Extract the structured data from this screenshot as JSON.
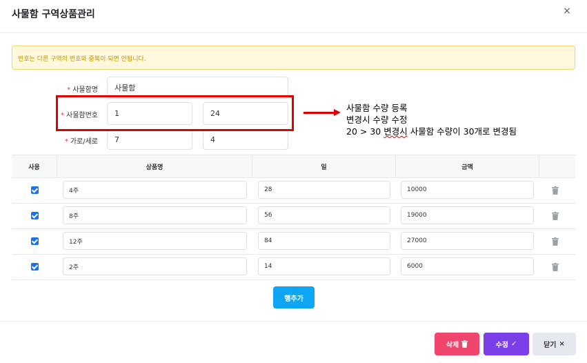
{
  "modal": {
    "title": "사물함 구역상품관리",
    "close_glyph": "×"
  },
  "alert": {
    "text": "번호는 다른 구역의 번호와 중복이 되면 안됩니다."
  },
  "form": {
    "locker_name_label": "사물함명",
    "locker_name_value": "사물함",
    "locker_number_label": "사물함번호",
    "locker_number_from": "1",
    "locker_number_to": "24",
    "size_label": "가로/세로",
    "width_value": "7",
    "height_value": "4",
    "required_mark": "*"
  },
  "annotation": {
    "line1": "사물함 수량 등록",
    "line2": "변경시 수량 수정",
    "line3_pre": "20 > 30 ",
    "line3_squiggle": "변경시",
    "line3_post": " 사물함 수량이 30개로 변경됨"
  },
  "table": {
    "headers": {
      "use": "사용",
      "product": "상품명",
      "days": "일",
      "price": "금액"
    },
    "rows": [
      {
        "checked": true,
        "product": "4주",
        "days": "28",
        "price": "10000"
      },
      {
        "checked": true,
        "product": "8주",
        "days": "56",
        "price": "19000"
      },
      {
        "checked": true,
        "product": "12주",
        "days": "84",
        "price": "27000"
      },
      {
        "checked": true,
        "product": "2주",
        "days": "14",
        "price": "6000"
      }
    ]
  },
  "buttons": {
    "add_row": "행추가",
    "delete": "삭제",
    "edit": "수정",
    "close": "닫기",
    "close_icon_glyph": "×",
    "check_glyph": "✓"
  },
  "colors": {
    "highlight": "#e00000",
    "primary": "#0fa5f5",
    "delete": "#f0466e",
    "edit": "#7a3fe8"
  }
}
